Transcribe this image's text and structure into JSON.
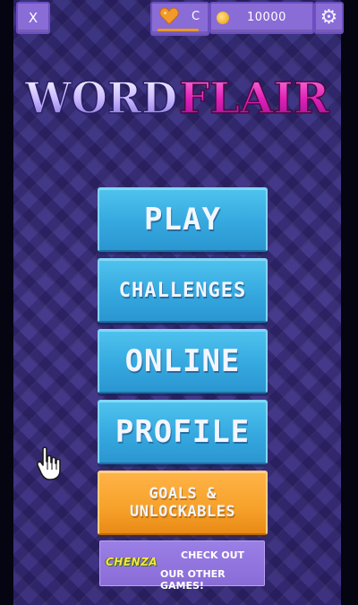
{
  "topbar": {
    "close_label": "X",
    "lives_label": "C",
    "coins": "10000"
  },
  "logo": {
    "word1": "WORD",
    "word2": "FLAIR"
  },
  "menu": {
    "play": "PLAY",
    "challenges": "CHALLENGES",
    "online": "ONLINE",
    "profile": "PROFILE",
    "goals_line1": "GOALS &",
    "goals_line2": "UNLOCKABLES"
  },
  "promo": {
    "brand": "CHENZA",
    "line1": "CHECK OUT",
    "line2": "OUR OTHER GAMES!"
  },
  "icons": {
    "lives": "heart-icon",
    "coins": "coin-icon",
    "settings": "gear-icon",
    "pointer": "hand-pointer-icon"
  },
  "colors": {
    "menu_button": "#35a8df",
    "goals_button": "#f6a12a",
    "top_button": "#8a6cd6",
    "logo_word1": "#c9b8ff",
    "logo_word2": "#e020b8"
  }
}
